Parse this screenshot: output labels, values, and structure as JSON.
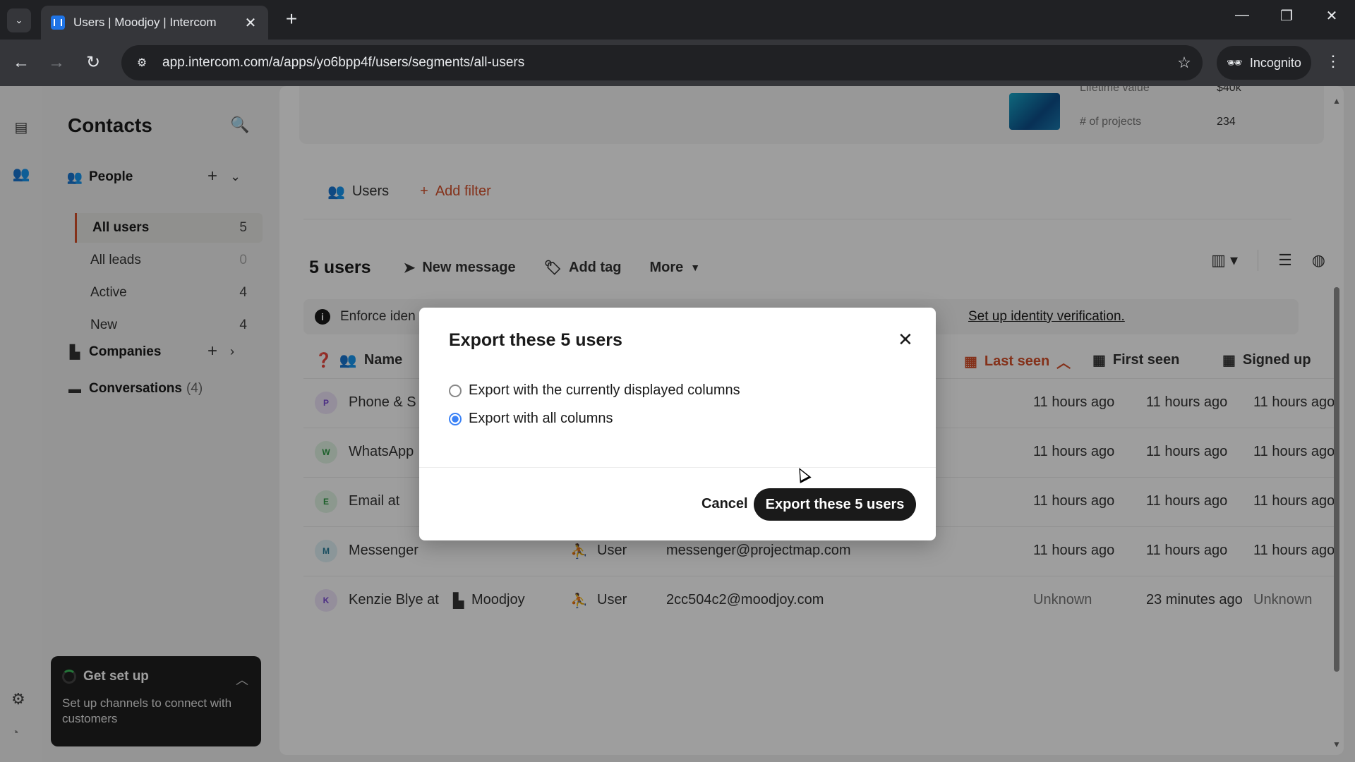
{
  "browser": {
    "tab_title": "Users | Moodjoy | Intercom",
    "url": "app.intercom.com/a/apps/yo6bpp4f/users/segments/all-users",
    "incognito_label": "Incognito"
  },
  "sidebar": {
    "title": "Contacts",
    "people_label": "People",
    "segments": [
      {
        "label": "All users",
        "count": "5"
      },
      {
        "label": "All leads",
        "count": "0"
      },
      {
        "label": "Active",
        "count": "4"
      },
      {
        "label": "New",
        "count": "4"
      }
    ],
    "companies_label": "Companies",
    "conversations_label": "Conversations",
    "conversations_count": "(4)",
    "get_setup": {
      "title": "Get set up",
      "text": "Set up channels to connect with customers"
    }
  },
  "top_card": {
    "lifetime_label": "Lifetime value",
    "lifetime_value": "$40k",
    "projects_label": "# of projects",
    "projects_value": "234"
  },
  "filters": {
    "users_chip": "Users",
    "add_filter": "Add filter"
  },
  "toolbar": {
    "count": "5 users",
    "new_message": "New message",
    "add_tag": "Add tag",
    "more": "More"
  },
  "banner": {
    "text": "Enforce iden",
    "link": "Set up identity verification."
  },
  "table": {
    "headers": {
      "name": "Name",
      "last_seen": "Last seen",
      "first_seen": "First seen",
      "signed_up": "Signed up"
    },
    "rows": [
      {
        "initial": "P",
        "name": "Phone & S",
        "company": "",
        "type": "",
        "email": "",
        "last_seen": "11 hours ago",
        "first_seen": "11 hours ago",
        "signed_up": "11 hours ago",
        "color": "#efe6fb",
        "fg": "#7b4bd6"
      },
      {
        "initial": "W",
        "name": "WhatsApp",
        "company": "",
        "type": "",
        "email": "",
        "last_seen": "11 hours ago",
        "first_seen": "11 hours ago",
        "signed_up": "11 hours ago",
        "color": "#e3f6e6",
        "fg": "#2f9c46"
      },
      {
        "initial": "E",
        "name": "Email at",
        "company": "",
        "type": "",
        "email": "",
        "last_seen": "11 hours ago",
        "first_seen": "11 hours ago",
        "signed_up": "11 hours ago",
        "color": "#e3f6e6",
        "fg": "#2f9c46"
      },
      {
        "initial": "M",
        "name": "Messenger",
        "company": "",
        "type": "User",
        "email": "messenger@projectmap.com",
        "last_seen": "11 hours ago",
        "first_seen": "11 hours ago",
        "signed_up": "11 hours ago",
        "color": "#e1f2f7",
        "fg": "#2a7f9b"
      },
      {
        "initial": "K",
        "name": "Kenzie Blye at",
        "company": "Moodjoy",
        "type": "User",
        "email": "2cc504c2@moodjoy.com",
        "last_seen": "Unknown",
        "first_seen": "23 minutes ago",
        "signed_up": "Unknown",
        "color": "#efe6fb",
        "fg": "#7b4bd6"
      }
    ]
  },
  "modal": {
    "title": "Export these 5 users",
    "option_displayed": "Export with the currently displayed columns",
    "option_all": "Export with all columns",
    "selected": "all",
    "cancel": "Cancel",
    "confirm": "Export these 5 users"
  }
}
